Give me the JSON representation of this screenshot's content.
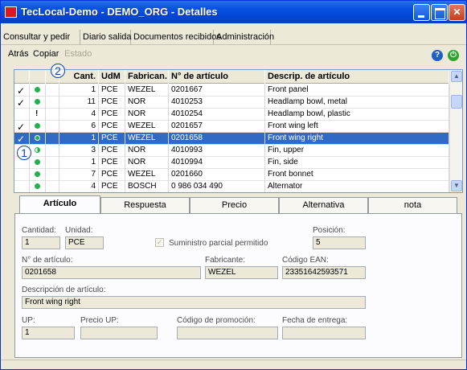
{
  "window": {
    "title": "TecLocal-Demo - DEMO_ORG - Detalles"
  },
  "menu": {
    "items": [
      {
        "label": "Consultar y pedir"
      },
      {
        "label": "Diario salida"
      },
      {
        "label": "Documentos recibidos"
      },
      {
        "label": "Administración"
      }
    ]
  },
  "toolbar": {
    "back_label": "Atrás",
    "copy_label": "Copiar",
    "status_label": "Estado"
  },
  "callouts": {
    "one": "1",
    "two": "2"
  },
  "grid": {
    "headers": {
      "qty": "Cant.",
      "unit": "UdM",
      "maker": "Fabrican.",
      "article_no": "N° de artículo",
      "description": "Descrip. de artículo"
    },
    "rows": [
      {
        "check": "✓",
        "qty": "1",
        "unit": "PCE",
        "maker": "WEZEL",
        "article_no": "0201667",
        "description": "Front panel"
      },
      {
        "check": "✓",
        "qty": "11",
        "unit": "PCE",
        "maker": "NOR",
        "article_no": "4010253",
        "description": "Headlamp bowl, metal"
      },
      {
        "check": "",
        "qty": "4",
        "unit": "PCE",
        "maker": "NOR",
        "article_no": "4010254",
        "description": "Headlamp bowl, plastic"
      },
      {
        "check": "✓",
        "qty": "6",
        "unit": "PCE",
        "maker": "WEZEL",
        "article_no": "0201657",
        "description": "Front wing left"
      },
      {
        "check": "✓",
        "qty": "1",
        "unit": "PCE",
        "maker": "WEZEL",
        "article_no": "0201658",
        "description": "Front wing right"
      },
      {
        "check": "",
        "qty": "3",
        "unit": "PCE",
        "maker": "NOR",
        "article_no": "4010993",
        "description": "Fin, upper"
      },
      {
        "check": "",
        "qty": "1",
        "unit": "PCE",
        "maker": "NOR",
        "article_no": "4010994",
        "description": "Fin, side"
      },
      {
        "check": "",
        "qty": "7",
        "unit": "PCE",
        "maker": "WEZEL",
        "article_no": "0201660",
        "description": "Front bonnet"
      },
      {
        "check": "",
        "qty": "4",
        "unit": "PCE",
        "maker": "BOSCH",
        "article_no": "0 986 034 490",
        "description": "Alternator"
      }
    ],
    "selected_row": 4
  },
  "tabs": [
    {
      "label": "Artículo"
    },
    {
      "label": "Respuesta"
    },
    {
      "label": "Precio"
    },
    {
      "label": "Alternativa"
    },
    {
      "label": "nota"
    }
  ],
  "detail": {
    "qty_label": "Cantidad:",
    "qty_value": "1",
    "unit_label": "Unidad:",
    "unit_value": "PCE",
    "partial_label": "Suministro parcial permitido",
    "position_label": "Posición:",
    "position_value": "5",
    "article_label": "N° de artículo:",
    "article_value": "0201658",
    "maker_label": "Fabricante:",
    "maker_value": "WEZEL",
    "ean_label": "Código EAN:",
    "ean_value": "23351642593571",
    "desc_label": "Descripción de artículo:",
    "desc_value": "Front wing right",
    "up_label": "UP:",
    "up_value": "1",
    "price_up_label": "Precio UP:",
    "price_up_value": "",
    "promo_label": "Código de promoción:",
    "promo_value": "",
    "delivery_label": "Fecha de entrega:",
    "delivery_value": ""
  },
  "colors": {
    "title_bar": "#0054e3",
    "selection": "#316ac5",
    "status_ok": "#22b14c"
  },
  "icons": {
    "help": "help-icon",
    "exit": "exit-icon"
  }
}
